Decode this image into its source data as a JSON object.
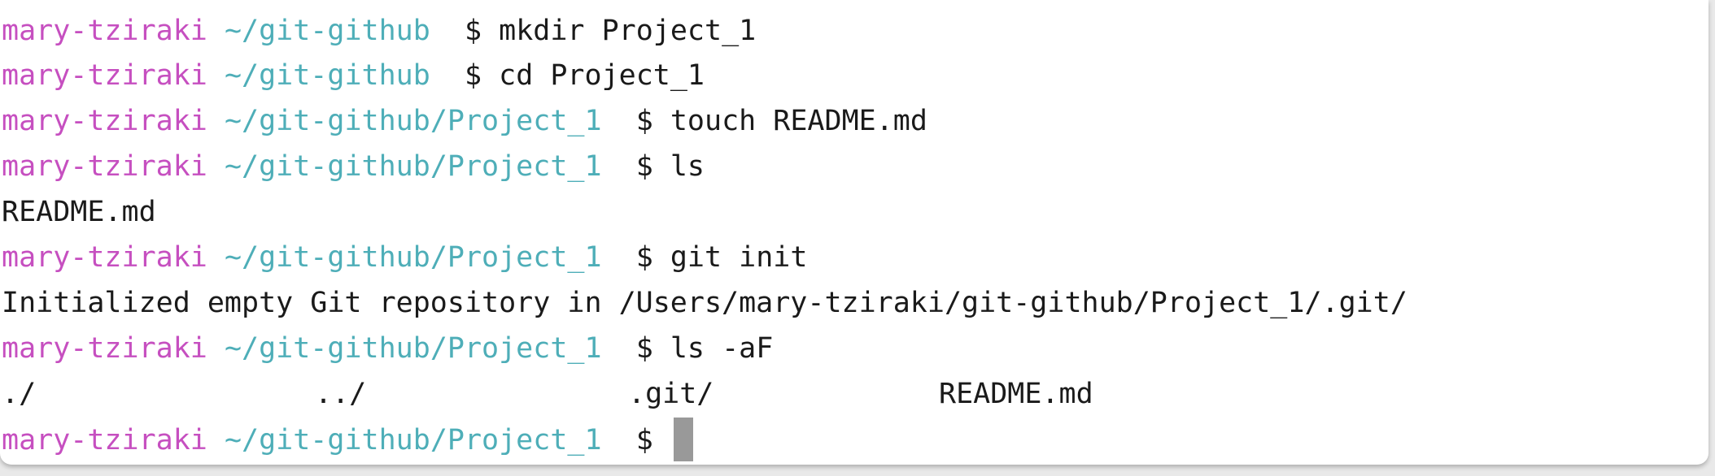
{
  "prompt": {
    "user": "mary-tziraki",
    "dollar": "$"
  },
  "lines": [
    {
      "path": "~/git-github",
      "command": "mkdir Project_1"
    },
    {
      "path": "~/git-github",
      "command": "cd Project_1"
    },
    {
      "path": "~/git-github/Project_1",
      "command": "touch README.md"
    },
    {
      "path": "~/git-github/Project_1",
      "command": "ls"
    },
    {
      "output": "README.md"
    },
    {
      "path": "~/git-github/Project_1",
      "command": "git init"
    },
    {
      "output": "Initialized empty Git repository in /Users/mary-tziraki/git-github/Project_1/.git/"
    },
    {
      "path": "~/git-github/Project_1",
      "command": "ls -aF"
    },
    {
      "columns": [
        "./",
        "../",
        ".git/",
        "README.md"
      ]
    },
    {
      "path": "~/git-github/Project_1",
      "command": ""
    }
  ],
  "colors": {
    "user": "#c64fc0",
    "path": "#4eaeb8",
    "text": "#1a1a1a",
    "cursor": "#999999",
    "background": "#ffffff"
  }
}
